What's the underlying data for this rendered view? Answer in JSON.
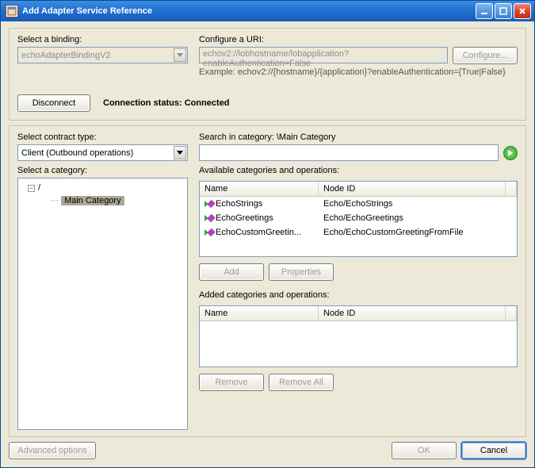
{
  "window": {
    "title": "Add Adapter Service Reference"
  },
  "binding": {
    "label": "Select a binding:",
    "value": "echoAdapterBindingV2"
  },
  "uri": {
    "label": "Configure a URI:",
    "value": "echov2://lobhostname/lobapplication?enableAuthentication=False",
    "configure_label": "Configure...",
    "example": "Example: echov2://{hostname}/{application}?enableAuthentication={True|False}"
  },
  "connection": {
    "disconnect_label": "Disconnect",
    "status_label": "Connection status:",
    "status_value": "Connected"
  },
  "contract": {
    "label": "Select contract type:",
    "value": "Client (Outbound operations)"
  },
  "search": {
    "label_prefix": "Search in category:",
    "category_path": "\\Main Category",
    "value": ""
  },
  "category": {
    "label": "Select a category:",
    "root": "/",
    "selected": "Main Category"
  },
  "available": {
    "label": "Available categories and operations:",
    "col_name": "Name",
    "col_nodeid": "Node ID",
    "items": [
      {
        "name": "EchoStrings",
        "nodeid": "Echo/EchoStrings"
      },
      {
        "name": "EchoGreetings",
        "nodeid": "Echo/EchoGreetings"
      },
      {
        "name": "EchoCustomGreetin...",
        "nodeid": "Echo/EchoCustomGreetingFromFile"
      }
    ],
    "add_label": "Add",
    "properties_label": "Properties"
  },
  "added": {
    "label": "Added categories and operations:",
    "col_name": "Name",
    "col_nodeid": "Node ID",
    "remove_label": "Remove",
    "removeall_label": "Remove All"
  },
  "footer": {
    "advanced_label": "Advanced options",
    "ok_label": "OK",
    "cancel_label": "Cancel"
  }
}
